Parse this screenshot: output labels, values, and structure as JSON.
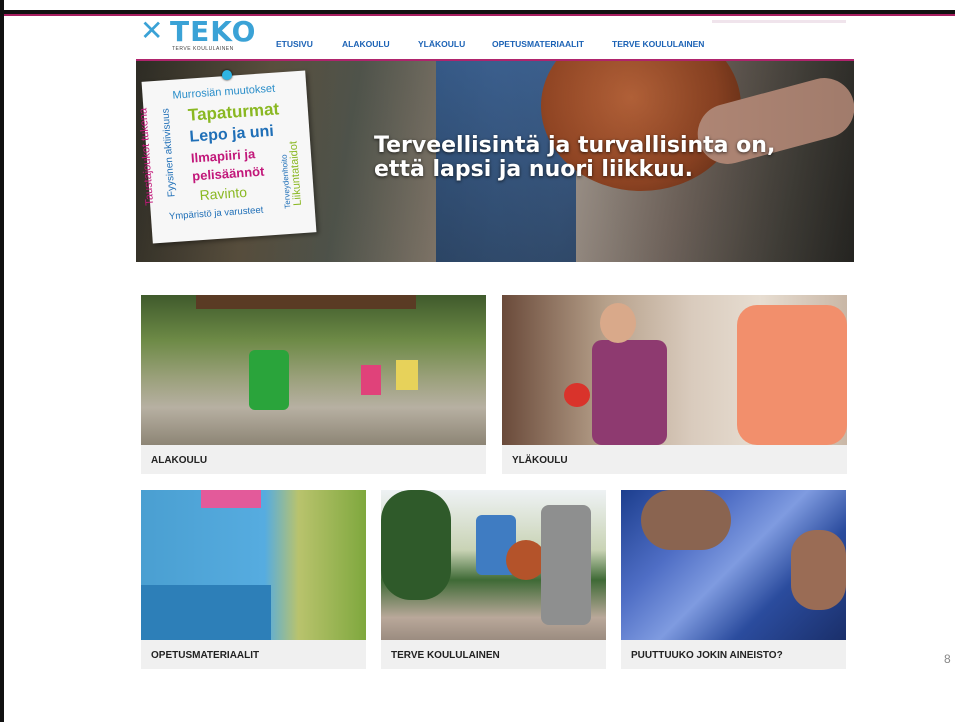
{
  "slide": {
    "number": "8"
  },
  "header": {
    "logo_text": "TEKO",
    "logo_subtitle": "TERVE KOULULAINEN",
    "nav": [
      "ETUSIVU",
      "ALAKOULU",
      "YLÄKOULU",
      "OPETUSMATERIAALIT",
      "TERVE KOULULAINEN"
    ]
  },
  "hero": {
    "headline_line1": "Terveellisintä ja turvallisinta on,",
    "headline_line2": "että lapsi ja nuori liikkuu.",
    "note_words": {
      "w1": "Murrosiän muutokset",
      "w2": "Tapaturmat",
      "w3": "Lepo ja uni",
      "w4": "Ilmapiiri ja",
      "w5": "pelisäännöt",
      "w6": "Ravinto",
      "w7": "Ympäristö ja varusteet",
      "w8": "Taustajoukot tukena",
      "w9": "Fyysinen aktiivisuus",
      "w10": "Terveydenhoito",
      "w11": "Liikuntataidot"
    }
  },
  "tiles": {
    "alakoulu": "ALAKOULU",
    "ylakoulu": "YLÄKOULU",
    "opetusmateriaalit": "OPETUSMATERIAALIT",
    "terve_koululainen": "TERVE KOULULAINEN",
    "puuttuuko": "PUUTTUUKO JOKIN AINEISTO?"
  },
  "colors": {
    "brand_blue": "#3aa2d6",
    "nav_blue": "#1b62b5",
    "accent_magenta": "#b0246d"
  }
}
